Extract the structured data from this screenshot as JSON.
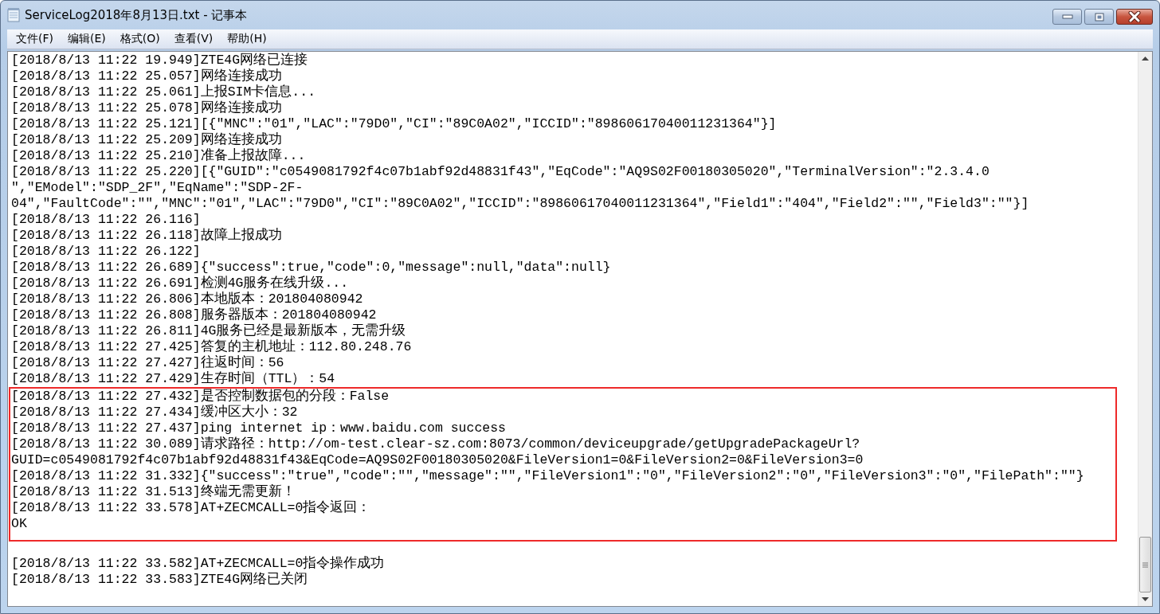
{
  "window": {
    "title": "ServiceLog2018年8月13日.txt - 记事本"
  },
  "menu": [
    "文件(F)",
    "编辑(E)",
    "格式(O)",
    "查看(V)",
    "帮助(H)"
  ],
  "editor": {
    "blocks": [
      {
        "kind": "plain",
        "lines": [
          "[2018/8/13 11:22 19.949]ZTE4G网络已连接",
          "[2018/8/13 11:22 25.057]网络连接成功",
          "[2018/8/13 11:22 25.061]上报SIM卡信息...",
          "[2018/8/13 11:22 25.078]网络连接成功",
          "[2018/8/13 11:22 25.121][{\"MNC\":\"01\",\"LAC\":\"79D0\",\"CI\":\"89C0A02\",\"ICCID\":\"89860617040011231364\"}]",
          "[2018/8/13 11:22 25.209]网络连接成功",
          "[2018/8/13 11:22 25.210]准备上报故障...",
          "[2018/8/13 11:22 25.220][{\"GUID\":\"c0549081792f4c07b1abf92d48831f43\",\"EqCode\":\"AQ9S02F00180305020\",\"TerminalVersion\":\"2.3.4.0",
          "\",\"EModel\":\"SDP_2F\",\"EqName\":\"SDP-2F-",
          "04\",\"FaultCode\":\"\",\"MNC\":\"01\",\"LAC\":\"79D0\",\"CI\":\"89C0A02\",\"ICCID\":\"89860617040011231364\",\"Field1\":\"404\",\"Field2\":\"\",\"Field3\":\"\"}]",
          "[2018/8/13 11:22 26.116]",
          "[2018/8/13 11:22 26.118]故障上报成功",
          "[2018/8/13 11:22 26.122]",
          "[2018/8/13 11:22 26.689]{\"success\":true,\"code\":0,\"message\":null,\"data\":null}",
          "[2018/8/13 11:22 26.691]检测4G服务在线升级...",
          "[2018/8/13 11:22 26.806]本地版本：201804080942",
          "[2018/8/13 11:22 26.808]服务器版本：201804080942",
          "[2018/8/13 11:22 26.811]4G服务已经是最新版本，无需升级",
          "[2018/8/13 11:22 27.425]答复的主机地址：112.80.248.76",
          "[2018/8/13 11:22 27.427]往返时间：56",
          "[2018/8/13 11:22 27.429]生存时间（TTL）：54"
        ]
      },
      {
        "kind": "highlighted",
        "lines": [
          "[2018/8/13 11:22 27.432]是否控制数据包的分段：False",
          "[2018/8/13 11:22 27.434]缓冲区大小：32",
          "[2018/8/13 11:22 27.437]ping internet ip：www.baidu.com success",
          "[2018/8/13 11:22 30.089]请求路径：http://om-test.clear-sz.com:8073/common/deviceupgrade/getUpgradePackageUrl?",
          "GUID=c0549081792f4c07b1abf92d48831f43&EqCode=AQ9S02F00180305020&FileVersion1=0&FileVersion2=0&FileVersion3=0",
          "[2018/8/13 11:22 31.332]{\"success\":\"true\",\"code\":\"\",\"message\":\"\",\"FileVersion1\":\"0\",\"FileVersion2\":\"0\",\"FileVersion3\":\"0\",\"FilePath\":\"\"}",
          "[2018/8/13 11:22 31.513]终端无需更新！",
          "[2018/8/13 11:22 33.578]AT+ZECMCALL=0指令返回：",
          "OK"
        ]
      },
      {
        "kind": "plain",
        "lines": [
          "[2018/8/13 11:22 33.582]AT+ZECMCALL=0指令操作成功",
          "[2018/8/13 11:22 33.583]ZTE4G网络已关闭"
        ]
      }
    ]
  }
}
